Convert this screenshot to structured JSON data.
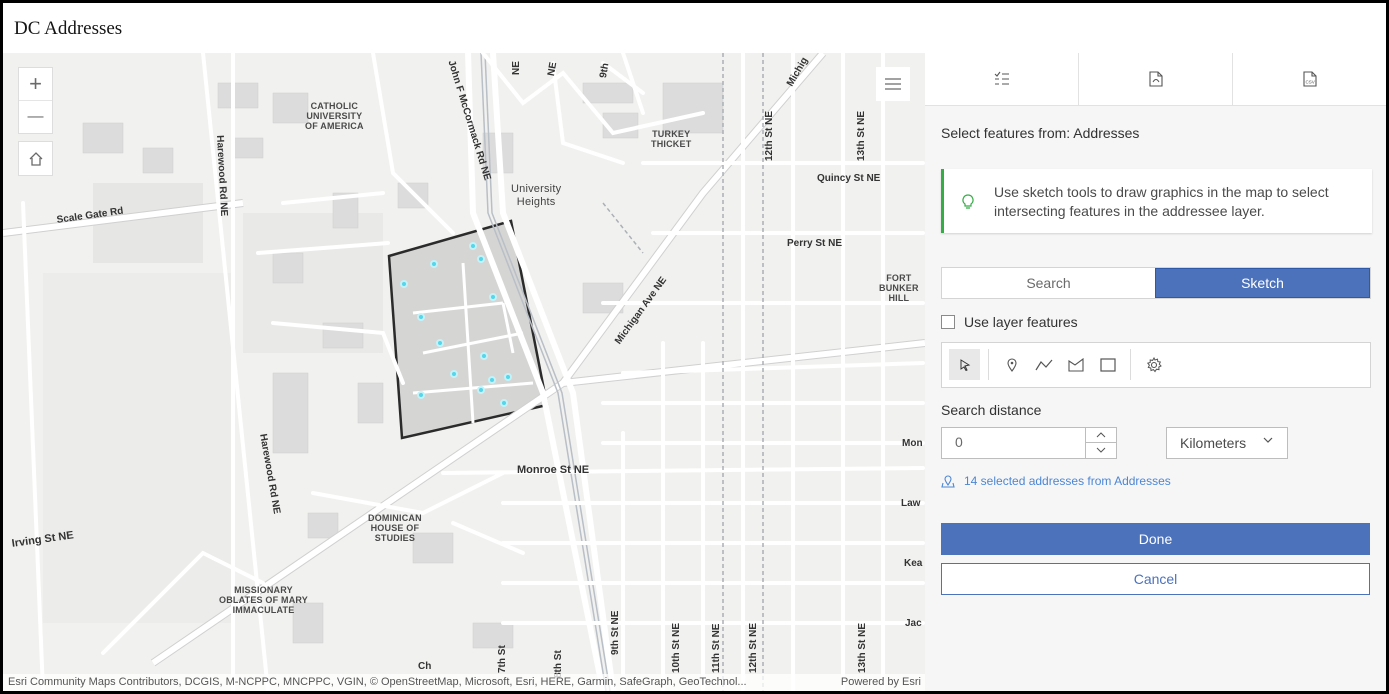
{
  "app": {
    "title": "DC Addresses"
  },
  "map": {
    "place_labels": {
      "catholic": "CATHOLIC\nUNIVERSITY\nOF AMERICA",
      "turkey": "TURKEY\nTHICKET",
      "university": "University\nHeights",
      "fort": "FORT\nBUNKER\nHILL",
      "dominican": "DOMINICAN\nHOUSE OF\nSTUDIES",
      "missionary": "MISSIONARY\nOBLATES OF MARY\nIMMACULATE"
    },
    "road_labels": {
      "scale_gate": "Scale Gate Rd",
      "harewood_1": "Harewood Rd NE",
      "harewood_2": "Harewood Rd NE",
      "john_mccormack": "John F McCormack Rd NE",
      "michigan": "Michigan Ave NE",
      "michigan_top": "Michig",
      "quincy": "Quincy St NE",
      "perry": "Perry St NE",
      "monroe": "Monroe St NE",
      "irving": "Irving St NE",
      "twelfth_top": "12th St NE",
      "thirteenth_top": "13th St NE",
      "ninth_top": "9th",
      "ne_top1": "NE",
      "ne_top2": "NE",
      "seventh": "7th St",
      "eighth": "8th St",
      "ninth": "9th St NE",
      "tenth": "10th St NE",
      "eleventh": "11th St NE",
      "twelfth": "12th St NE",
      "thirteenth": "13th St NE",
      "mon": "Mon",
      "law": "Law",
      "kea": "Kea",
      "jac": "Jac",
      "ch": "Ch",
      "st": "St"
    },
    "zoom_in_symbol": "+",
    "zoom_out_symbol": "—",
    "attribution": "Esri Community Maps Contributors, DCGIS, M-NCPPC, MNCPPC, VGIN, © OpenStreetMap, Microsoft, Esri, HERE, Garmin, SafeGraph, GeoTechnol...",
    "powered_by": "Powered by Esri",
    "selection_outline_color": "#2b2b2b",
    "point_color": "#55d6ea"
  },
  "panel": {
    "tabs": [
      {
        "icon": "checklist-icon"
      },
      {
        "icon": "pdf-icon"
      },
      {
        "icon": "csv-icon"
      }
    ],
    "select_from": "Select features from: Addresses",
    "notice": "Use sketch tools to draw graphics in the map to select intersecting features in the addressee layer.",
    "mode_options": [
      "Search",
      "Sketch"
    ],
    "selected_mode": "Sketch",
    "use_layer_features": "Use layer features",
    "sketch_tools": [
      "select-cursor-icon",
      "point-icon",
      "polyline-icon",
      "polygon-icon",
      "rectangle-icon",
      "settings-icon"
    ],
    "search_distance_label": "Search distance",
    "search_distance_value": "0",
    "unit": "Kilometers",
    "selected_count_text": "14 selected addresses from Addresses",
    "done": "Done",
    "cancel": "Cancel",
    "accent_color": "#4c72bb",
    "notice_color": "#35ac46"
  }
}
